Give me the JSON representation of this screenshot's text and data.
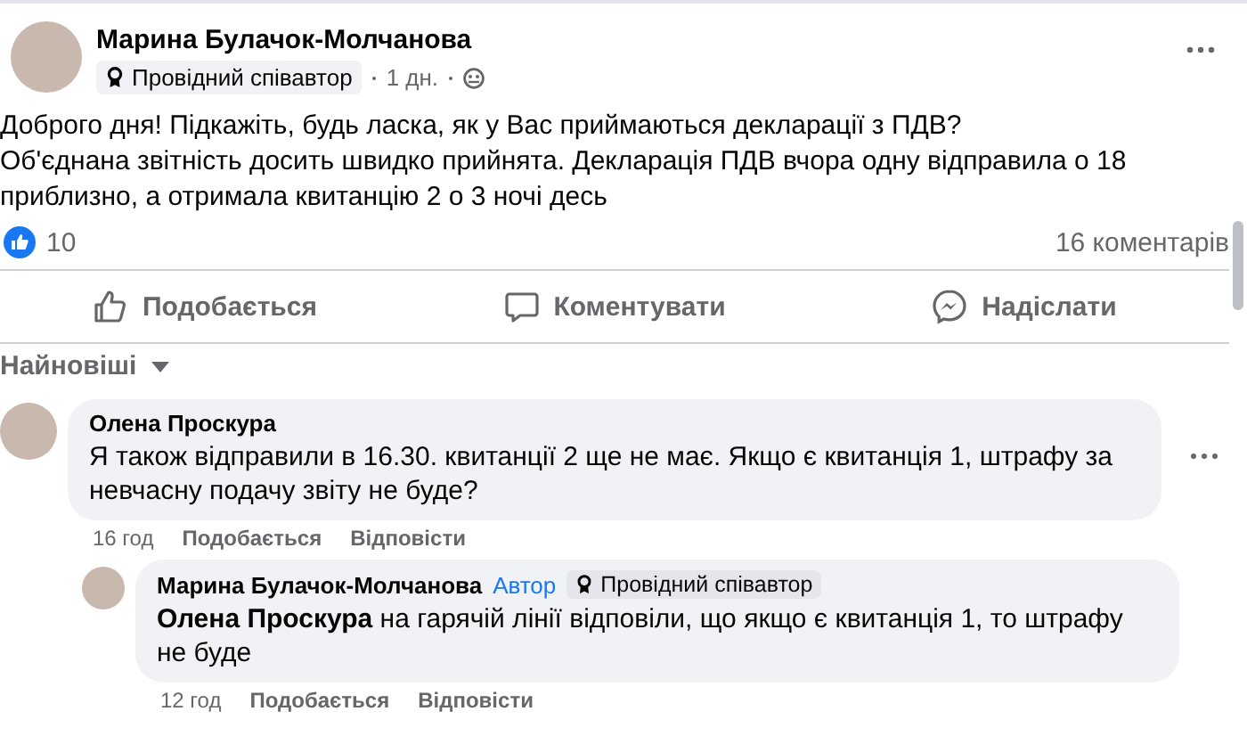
{
  "post": {
    "author": "Марина Булачок-Молчанова",
    "badge": "Провідний співавтор",
    "time": "1 дн.",
    "text": "Доброго дня! Підкажіть, будь ласка, як у Вас приймаються декларації з ПДВ?\nОб'єднана звітність досить швидко прийнята. Декларація ПДВ вчора одну відправила о 18 приблизно, а отримала квитанцію 2 о 3 ночі десь",
    "likes": "10",
    "comments_count": "16 коментарів"
  },
  "actions": [
    {
      "kind": "like",
      "label": "Подобається"
    },
    {
      "kind": "comment",
      "label": "Коментувати"
    },
    {
      "kind": "send",
      "label": "Надіслати"
    }
  ],
  "sort": "Найновіші",
  "comments": [
    {
      "author": "Олена Проскура",
      "text": "Я також відправили в 16.30. квитанції 2 ще не має. Якщо є квитанція 1, штрафу за невчасну подачу звіту не буде?",
      "time": "16 год",
      "actions": [
        "Подобається",
        "Відповісти"
      ],
      "replies": [
        {
          "author": "Марина Булачок-Молчанова",
          "author_tag": "Автор",
          "badge": "Провідний співавтор",
          "text": "**Олена Проскура** на гарячій лінії відповіли, що якщо є квитанція 1, то штрафу не буде",
          "time": "12 год",
          "actions": [
            "Подобається",
            "Відповісти"
          ]
        }
      ]
    }
  ]
}
